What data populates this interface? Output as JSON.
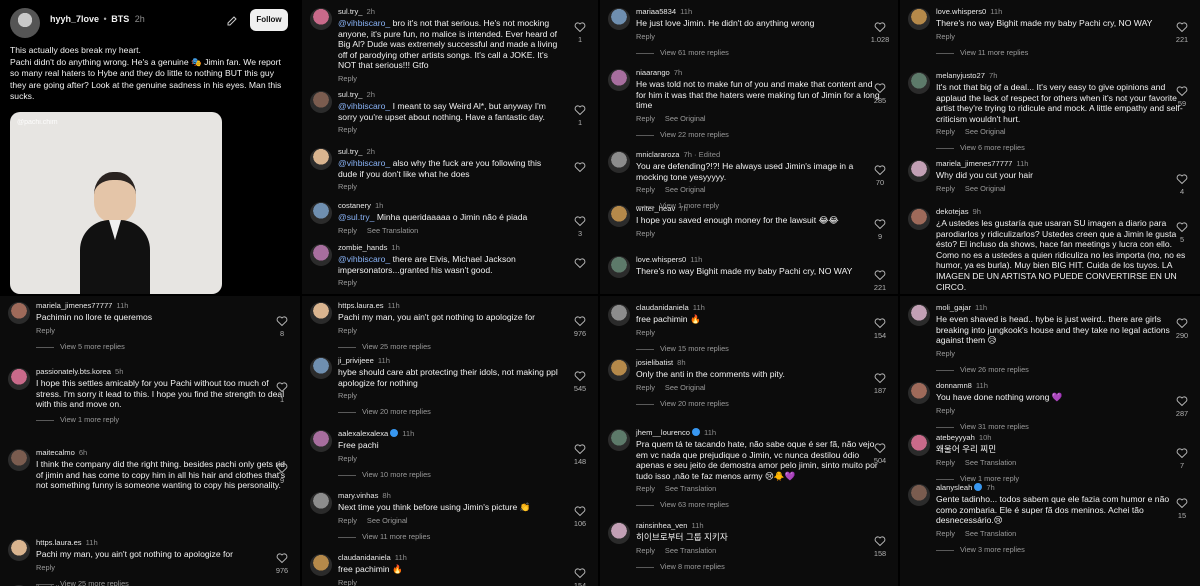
{
  "post": {
    "username": "hyyh_7love",
    "separator": "•",
    "tag": "BTS",
    "time": "2h",
    "follow_label": "Follow",
    "caption": "This actually does break my heart.\nPachi didn't do anything wrong. He's a genuine 🎭 Jimin fan. We report so many real haters to Hybe and they do little to nothing BUT this guy they are going after? Look at the genuine sadness in his eyes. Man this sucks.",
    "video_handle": "@pachi.chim"
  },
  "panels": [
    {
      "id": "p1",
      "comments": [
        {
          "user": "sul.try_",
          "time": "2h",
          "text": "@vihbiscaro_ bro it's not that serious. He's not mocking anyone, it's pure fun, no malice is intended. Ever heard of Big Al? Dude was extremely successful and made a living off of parodying other artists songs. It's call a JOKE. It's NOT that serious!!! Gtfo",
          "actions": [
            "Reply"
          ],
          "likes": "1"
        },
        {
          "user": "sul.try_",
          "time": "2h",
          "text": "@vihbiscaro_ I meant to say Weird Al*, but anyway I'm sorry you're upset about nothing. Have a fantastic day.",
          "actions": [
            "Reply"
          ],
          "likes": "1"
        },
        {
          "user": "sul.try_",
          "time": "2h",
          "text": "@vihbiscaro_ also why the fuck are you following this dude if you don't like what he does",
          "actions": [
            "Reply"
          ],
          "likes": ""
        },
        {
          "user": "costanery",
          "time": "1h",
          "text": "@sul.try_ Minha queridaaaaa o Jimin não é piada",
          "actions": [
            "Reply",
            "See Translation"
          ],
          "likes": "3"
        },
        {
          "user": "zombie_hands",
          "time": "1h",
          "text": "@vihbiscaro_ there are Elvis, Michael Jackson impersonators...granted his wasn't good.",
          "actions": [
            "Reply"
          ],
          "likes": ""
        }
      ]
    },
    {
      "id": "p2",
      "comments": [
        {
          "user": "mariaa5834",
          "time": "11h",
          "text": "He just love Jimin. He didn't do anything wrong",
          "actions": [
            "Reply"
          ],
          "likes": "1.028",
          "more": "View 61 more replies"
        },
        {
          "user": "niaarango",
          "time": "7h",
          "text": "He was told not to make fun of you and make that content and for him it was that the haters were making fun of Jimin for a long time",
          "actions": [
            "Reply",
            "See Original"
          ],
          "likes": "285",
          "more": "View 22 more replies"
        },
        {
          "user": "mniclararoza",
          "time": "7h · Edited",
          "text": "You are defending?!?! He always used Jimin's image in a mocking tone yesyyyyy.",
          "actions": [
            "Reply",
            "See Original"
          ],
          "likes": "70",
          "more": "View 1 more reply"
        },
        {
          "user": "writer_heav",
          "time": "7h",
          "text": "I hope you saved enough money for the lawsuit 😂😂",
          "actions": [
            "Reply"
          ],
          "likes": "9"
        },
        {
          "user": "love.whispers0",
          "time": "11h",
          "text": "There's no way Bighit made my baby Pachi cry, NO WAY",
          "actions": [],
          "likes": "221"
        }
      ]
    },
    {
      "id": "p3",
      "comments": [
        {
          "user": "love.whispers0",
          "time": "11h",
          "text": "There's no way Bighit made my baby Pachi cry, NO WAY",
          "actions": [
            "Reply"
          ],
          "likes": "221",
          "more": "View 11 more replies"
        },
        {
          "user": "melanyjusto27",
          "time": "7h",
          "text": "It's not that big of a deal... It's very easy to give opinions and applaud the lack of respect for others when it's not your favorite artist they're trying to ridicule and mock. A little empathy and self-criticism wouldn't hurt.",
          "actions": [
            "Reply",
            "See Original"
          ],
          "likes": "59",
          "more": "View 6 more replies"
        },
        {
          "user": "mariela_jimenes77777",
          "time": "11h",
          "text": "Why did you cut your hair",
          "actions": [
            "Reply",
            "See Original"
          ],
          "likes": "4"
        },
        {
          "user": "dekotejas",
          "time": "9h",
          "text": "¿A ustedes les gustaría que usaran SU imagen a diario para parodiarlos y ridiculizarlos? Ustedes creen que a Jimin le gusta ésto? El incluso da shows, hace fan meetings y lucra con ello. Como no es a ustedes a quien ridiculiza no les importa (no, no es humor, ya es burla). Muy bien BIG HIT. Cuida de los tuyos. LA IMAGEN DE UN ARTISTA NO PUEDE CONVERTIRSE EN UN CIRCO.",
          "actions": [],
          "likes": "5"
        }
      ]
    },
    {
      "id": "p4",
      "comments": [
        {
          "user": "mariela_jimenes77777",
          "time": "11h",
          "text": "Pachimin no llore te queremos",
          "actions": [
            "Reply"
          ],
          "likes": "8",
          "more": "View 5 more replies"
        },
        {
          "user": "passionately.bts.korea",
          "time": "5h",
          "text": "I hope this settles amicably for you Pachi without too much of stress. I'm sorry it lead to this. I hope you find the strength to deal with this and move on.",
          "actions": [],
          "likes": "1",
          "more": "View 1 more reply"
        },
        {
          "user": "maitecalmo",
          "time": "6h",
          "text": "I think the company did the right thing. besides pachi only gets rid of jimin and has come to copy him in all his hair and clothes that's not something funny is someone wanting to copy his personality.",
          "actions": [],
          "likes": "9"
        },
        {
          "user": "https.laura.es",
          "time": "11h",
          "text": "Pachi my man, you ain't got nothing to apologize for",
          "actions": [
            "Reply"
          ],
          "likes": "976",
          "more": "View 25 more replies"
        },
        {
          "user": "ji_privijeee",
          "time": "11h",
          "text": "",
          "actions": [],
          "likes": ""
        }
      ]
    },
    {
      "id": "p5",
      "comments": [
        {
          "user": "https.laura.es",
          "time": "11h",
          "text": "Pachi my man, you ain't got nothing to apologize for",
          "actions": [
            "Reply"
          ],
          "likes": "976",
          "more": "View 25 more replies"
        },
        {
          "user": "ji_privijeee",
          "time": "11h",
          "text": "hybe should care abt protecting their idols, not making ppl apologize for nothing",
          "actions": [
            "Reply"
          ],
          "likes": "545",
          "more": "View 20 more replies"
        },
        {
          "user": "aalexalexalexa",
          "time": "11h",
          "verified": true,
          "text": "Free pachi",
          "actions": [
            "Reply"
          ],
          "likes": "148",
          "more": "View 10 more replies"
        },
        {
          "user": "mary.vinhas",
          "time": "8h",
          "text": "Next time you think before using Jimin's picture 👏",
          "actions": [
            "Reply",
            "See Original"
          ],
          "likes": "106",
          "more": "View 11 more replies"
        },
        {
          "user": "claudanidaniela",
          "time": "11h",
          "text": "free pachimin 🔥",
          "actions": [
            "Reply"
          ],
          "likes": "154"
        }
      ]
    },
    {
      "id": "p6",
      "comments": [
        {
          "user": "claudanidaniela",
          "time": "11h",
          "text": "free pachimin 🔥",
          "actions": [
            "Reply"
          ],
          "likes": "154",
          "more": "View 15 more replies"
        },
        {
          "user": "josielibatist",
          "time": "8h",
          "text": "Only the anti in the comments with pity.",
          "actions": [
            "Reply",
            "See Original"
          ],
          "likes": "187",
          "more": "View 20 more replies"
        },
        {
          "user": "jhem__lourenco",
          "time": "11h",
          "verified": true,
          "text": "Pra quem tá te tacando hate, não sabe oque é ser fã, não vejo em vc nada que prejudique o Jimin, vc nunca destilou ódio apenas e seu jeito de demostra amor pelo jimin, sinto muito por tudo isso ,não te faz menos army 😢🐥💜",
          "actions": [
            "Reply",
            "See Translation"
          ],
          "likes": "504",
          "more": "View 63 more replies"
        },
        {
          "user": "rainsinhea_ven",
          "time": "11h",
          "text": "히이브로부터 그룹 지키자",
          "actions": [
            "Reply",
            "See Translation"
          ],
          "likes": "158",
          "more": "View 8 more replies"
        }
      ]
    },
    {
      "id": "p7",
      "comments": [
        {
          "user": "moli_gajar",
          "time": "11h",
          "text": "He even shaved is head.. hybe is just weird.. there are girls breaking into jungkook's house and they take no legal actions against them 😥",
          "actions": [
            "Reply"
          ],
          "likes": "290",
          "more": "View 26 more replies"
        },
        {
          "user": "donnamn8",
          "time": "11h",
          "text": "You have done nothing wrong 💜",
          "actions": [
            "Reply"
          ],
          "likes": "287",
          "more": "View 31 more replies"
        },
        {
          "user": "atebeyyyah",
          "time": "10h",
          "text": "왜울어 우리 찌민",
          "actions": [
            "Reply",
            "See Translation"
          ],
          "likes": "7",
          "more": "View 1 more reply"
        },
        {
          "user": "alanysleah",
          "time": "7h",
          "verified": true,
          "text": "Gente tadinho... todos sabem que ele fazia com humor e não como zombaria. Ele é super fã dos meninos. Achei tão desnecessário.😢",
          "actions": [
            "Reply",
            "See Translation"
          ],
          "likes": "15",
          "more": "View 3 more replies"
        }
      ]
    }
  ],
  "colors": {
    "bg": "#0c0c0c",
    "text": "#f2f2f2",
    "muted": "#9a9a9a",
    "mention": "#8ab4f8",
    "verified": "#3897f0"
  }
}
